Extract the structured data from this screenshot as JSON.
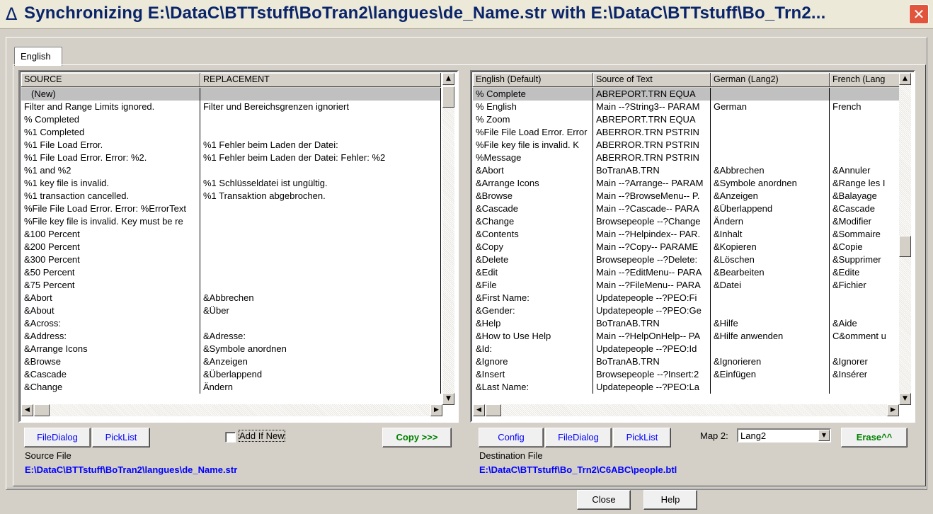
{
  "window": {
    "title_icon": "Δ",
    "title": "Synchronizing E:\\DataC\\BTTstuff\\BoTran2\\langues\\de_Name.str with E:\\DataC\\BTTstuff\\Bo_Trn2...",
    "close_glyph": "✕"
  },
  "tab": {
    "label": "English"
  },
  "source_grid": {
    "columns": [
      "SOURCE",
      "REPLACEMENT"
    ],
    "rows": [
      [
        "(New)",
        ""
      ],
      [
        "Filter and Range Limits ignored.",
        "Filter und Bereichsgrenzen ignoriert"
      ],
      [
        "% Completed",
        ""
      ],
      [
        "%1 Completed",
        ""
      ],
      [
        "%1 File Load Error.",
        "%1 Fehler beim Laden der Datei:"
      ],
      [
        "%1 File Load Error.  Error: %2.",
        "%1 Fehler beim Laden der Datei: Fehler: %2"
      ],
      [
        "%1 and %2",
        ""
      ],
      [
        "%1 key file is invalid.",
        "%1 Schlüsseldatei ist ungültig."
      ],
      [
        "%1 transaction cancelled.",
        "%1 Transaktion abgebrochen."
      ],
      [
        "%File File Load Error.  Error: %ErrorText",
        ""
      ],
      [
        "%File key file is invalid. Key must be re",
        ""
      ],
      [
        "&100 Percent",
        ""
      ],
      [
        "&200 Percent",
        ""
      ],
      [
        "&300 Percent",
        ""
      ],
      [
        "&50 Percent",
        ""
      ],
      [
        "&75 Percent",
        ""
      ],
      [
        "&Abort",
        "&Abbrechen"
      ],
      [
        "&About",
        "&Über"
      ],
      [
        "&Across:",
        ""
      ],
      [
        "&Address:",
        "&Adresse:"
      ],
      [
        "&Arrange Icons",
        "&Symbole anordnen"
      ],
      [
        "&Browse",
        "&Anzeigen"
      ],
      [
        "&Cascade",
        "&Überlappend"
      ],
      [
        "&Change",
        "Ändern"
      ]
    ]
  },
  "dest_grid": {
    "columns": [
      "English (Default)",
      "Source of Text",
      "German (Lang2)",
      "French (Lang"
    ],
    "rows": [
      [
        "% Complete",
        "ABREPORT.TRN EQUA",
        "",
        ""
      ],
      [
        "% English",
        "Main --?String3-- PARAM",
        "German",
        "French"
      ],
      [
        "% Zoom",
        "ABREPORT.TRN EQUA",
        "",
        ""
      ],
      [
        "%File File Load Error.  Error",
        "ABERROR.TRN PSTRIN",
        "",
        ""
      ],
      [
        "%File key file is invalid. K",
        "ABERROR.TRN PSTRIN",
        "",
        ""
      ],
      [
        "%Message",
        "ABERROR.TRN PSTRIN",
        "",
        ""
      ],
      [
        "&Abort",
        "BoTranAB.TRN",
        "&Abbrechen",
        "&Annuler"
      ],
      [
        "&Arrange Icons",
        "Main --?Arrange-- PARAM",
        "&Symbole anordnen",
        "&Range les I"
      ],
      [
        "&Browse",
        "Main --?BrowseMenu-- P.",
        "&Anzeigen",
        "&Balayage"
      ],
      [
        "&Cascade",
        "Main --?Cascade-- PARA",
        "&Überlappend",
        "&Cascade"
      ],
      [
        "&Change",
        "Browsepeople --?Change",
        "Ändern",
        "&Modifier"
      ],
      [
        "&Contents",
        "Main --?Helpindex-- PAR.",
        "&Inhalt",
        "&Sommaire"
      ],
      [
        "&Copy",
        "Main --?Copy-- PARAME",
        "&Kopieren",
        "&Copie"
      ],
      [
        "&Delete",
        "Browsepeople --?Delete:",
        "&Löschen",
        "&Supprimer"
      ],
      [
        "&Edit",
        "Main --?EditMenu-- PARA",
        "&Bearbeiten",
        "&Edite"
      ],
      [
        "&File",
        "Main --?FileMenu-- PARA",
        "&Datei",
        "&Fichier"
      ],
      [
        "&First Name:",
        "Updatepeople --?PEO:Fi",
        "",
        ""
      ],
      [
        "&Gender:",
        "Updatepeople --?PEO:Ge",
        "",
        ""
      ],
      [
        "&Help",
        "BoTranAB.TRN",
        "&Hilfe",
        "&Aide"
      ],
      [
        "&How to Use Help",
        "Main --?HelpOnHelp-- PA",
        "&Hilfe anwenden",
        "C&omment u"
      ],
      [
        "&Id:",
        "Updatepeople --?PEO:Id",
        "",
        ""
      ],
      [
        "&Ignore",
        "BoTranAB.TRN",
        "&Ignorieren",
        "&Ignorer"
      ],
      [
        "&Insert",
        "Browsepeople --?Insert:2",
        "&Einfügen",
        "&Insérer"
      ],
      [
        "&Last Name:",
        "Updatepeople --?PEO:La",
        "",
        ""
      ]
    ]
  },
  "source_panel": {
    "filedialog": "FileDialog",
    "picklist": "PickList",
    "add_if_new": "Add If New",
    "copy": "Copy >>>",
    "file_label": "Source File",
    "file_path": "E:\\DataC\\BTTstuff\\BoTran2\\langues\\de_Name.str"
  },
  "dest_panel": {
    "config": "Config",
    "filedialog": "FileDialog",
    "picklist": "PickList",
    "map2_label": "Map 2:",
    "map2_value": "Lang2",
    "erase": "Erase^^",
    "file_label": "Destination File",
    "file_path": "E:\\DataC\\BTTstuff\\Bo_Trn2\\C6ABC\\people.btl"
  },
  "footer": {
    "close": "Close",
    "help": "Help"
  },
  "icons": {
    "scroll_up": "▲",
    "scroll_down": "▼",
    "scroll_left": "◀",
    "scroll_right": "▶",
    "dropdown": "▼"
  }
}
